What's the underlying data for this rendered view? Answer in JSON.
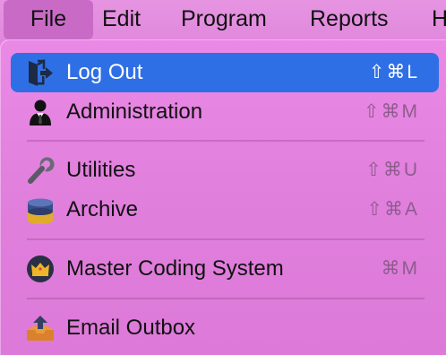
{
  "menubar": {
    "items": [
      {
        "label": "File"
      },
      {
        "label": "Edit"
      },
      {
        "label": "Program"
      },
      {
        "label": "Reports"
      },
      {
        "label": "H"
      }
    ]
  },
  "menu": {
    "items": [
      {
        "label": "Log Out",
        "shortcut": "⇧⌘L",
        "icon": "logout-door-icon",
        "highlighted": true
      },
      {
        "label": "Administration",
        "shortcut": "⇧⌘M",
        "icon": "administrator-icon"
      },
      {
        "label": "Utilities",
        "shortcut": "⇧⌘U",
        "icon": "wrench-icon"
      },
      {
        "label": "Archive",
        "shortcut": "⇧⌘A",
        "icon": "database-icon"
      },
      {
        "label": "Master Coding System",
        "shortcut": "⌘M",
        "icon": "crown-icon"
      },
      {
        "label": "Email Outbox",
        "shortcut": "",
        "icon": "outbox-tray-icon"
      }
    ]
  },
  "colors": {
    "highlight": "#2f6fe6",
    "menu_background": "#e283df",
    "shortcut_text": "#8e5c8e"
  }
}
